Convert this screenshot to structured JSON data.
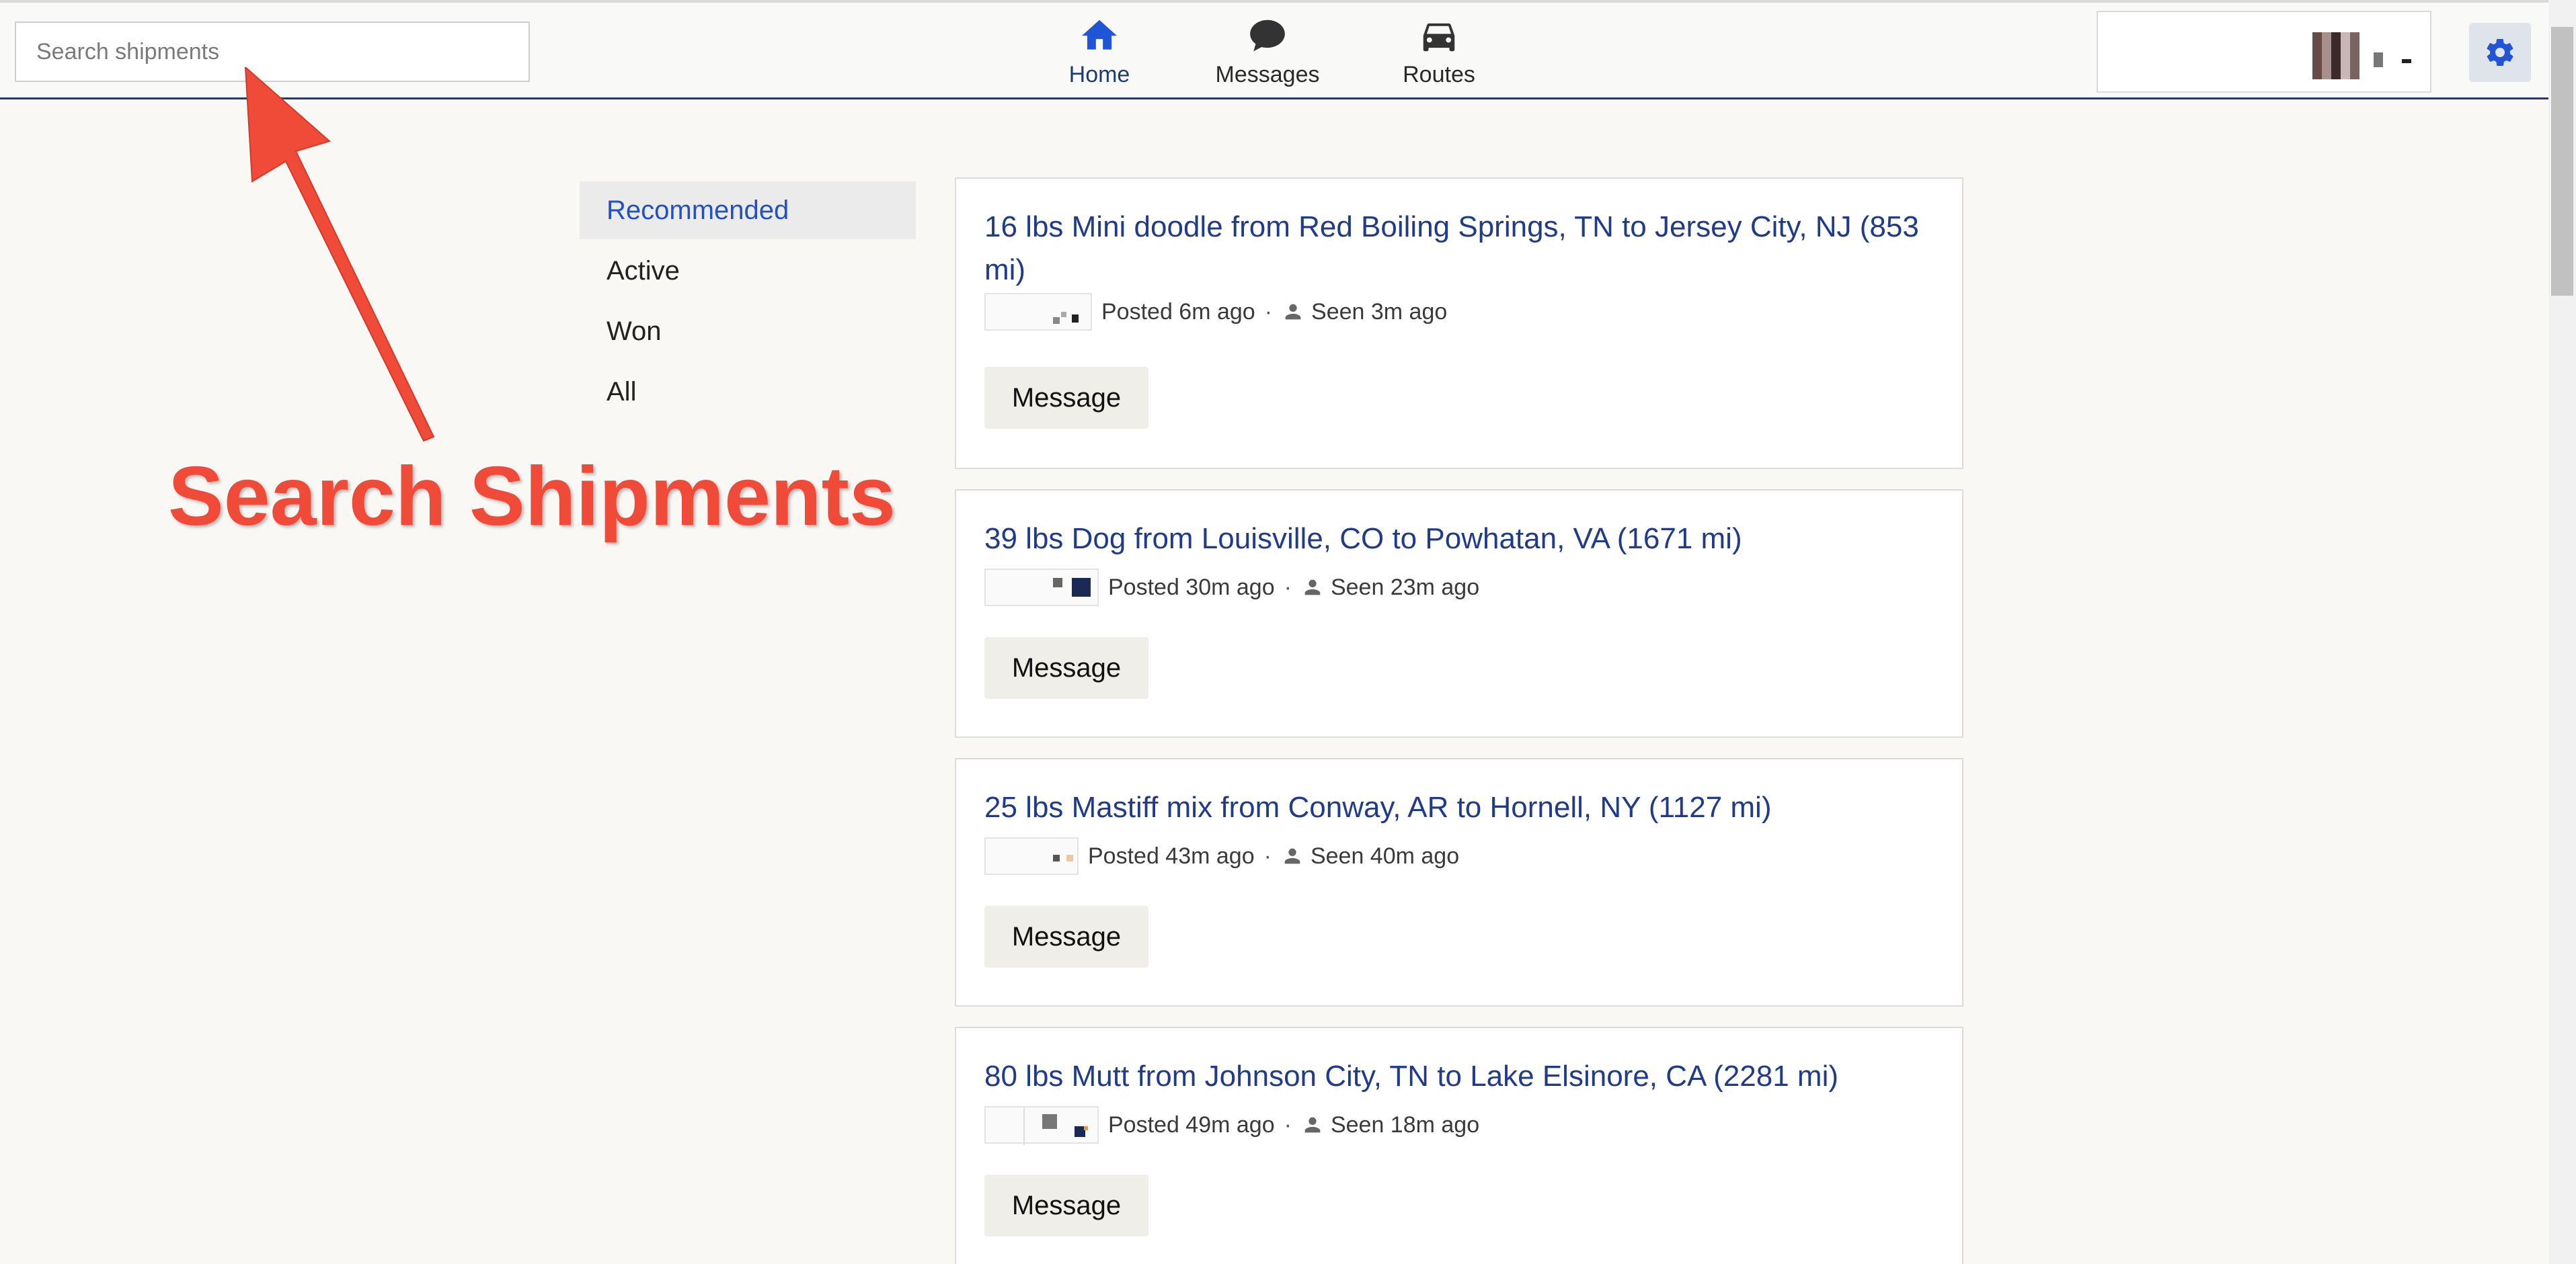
{
  "search": {
    "placeholder": "Search shipments"
  },
  "nav": {
    "home": {
      "label": "Home",
      "icon": "home-icon"
    },
    "messages": {
      "label": "Messages",
      "icon": "chat-bubble-icon"
    },
    "routes": {
      "label": "Routes",
      "icon": "car-icon"
    }
  },
  "settings": {
    "icon": "gear-icon"
  },
  "tabs": [
    {
      "label": "Recommended",
      "active": true
    },
    {
      "label": "Active"
    },
    {
      "label": "Won"
    },
    {
      "label": "All"
    }
  ],
  "annotation": {
    "text": "Search Shipments",
    "color": "#f04a38"
  },
  "shipments": [
    {
      "title": "16 lbs Mini doodle from Red Boiling Springs, TN to Jersey City, NJ (853 mi)",
      "posted": "Posted 6m ago",
      "seen": "Seen 3m ago",
      "button": "Message"
    },
    {
      "title": "39 lbs Dog from Louisville, CO to Powhatan, VA (1671 mi)",
      "posted": "Posted 30m ago",
      "seen": "Seen 23m ago",
      "button": "Message"
    },
    {
      "title": "25 lbs Mastiff mix from Conway, AR to Hornell, NY (1127 mi)",
      "posted": "Posted 43m ago",
      "seen": "Seen 40m ago",
      "button": "Message"
    },
    {
      "title": "80 lbs Mutt from Johnson City, TN to Lake Elsinore, CA (2281 mi)",
      "posted": "Posted 49m ago",
      "seen": "Seen 18m ago",
      "button": "Message"
    }
  ],
  "colors": {
    "accent": "#1f3b8a",
    "active_tab": "#2151c5",
    "header_border": "#1f3b73"
  }
}
